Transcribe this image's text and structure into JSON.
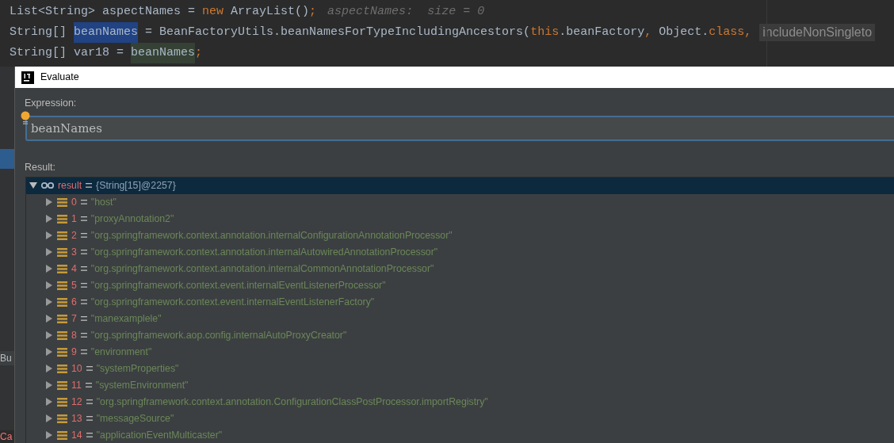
{
  "editor": {
    "lines": [
      [
        {
          "text": "List<String> aspectNames = ",
          "kind": "plain"
        },
        {
          "text": "new",
          "kind": "keyword"
        },
        {
          "text": " ArrayList()",
          "kind": "plain"
        },
        {
          "text": ";",
          "kind": "keyword"
        },
        {
          "text": "aspectNames:  size = 0",
          "kind": "hint"
        }
      ],
      [
        {
          "text": "String[] ",
          "kind": "plain"
        },
        {
          "text": "beanNames",
          "kind": "selection"
        },
        {
          "text": " = BeanFactoryUtils.beanNamesForTypeIncludingAncestors(",
          "kind": "plain"
        },
        {
          "text": "this",
          "kind": "keyword"
        },
        {
          "text": ".beanFactory",
          "kind": "plain"
        },
        {
          "text": ", ",
          "kind": "keyword"
        },
        {
          "text": "Object.",
          "kind": "plain"
        },
        {
          "text": "class",
          "kind": "keyword"
        },
        {
          "text": ",",
          "kind": "keyword"
        },
        {
          "text": "includeNonSingleto",
          "kind": "param"
        }
      ],
      [
        {
          "text": "String[] var18 = ",
          "kind": "plain"
        },
        {
          "text": "beanNames",
          "kind": "usage"
        },
        {
          "text": ";",
          "kind": "keyword"
        }
      ]
    ]
  },
  "side_panel": {
    "fragments": [
      {
        "text": "Bu",
        "kind": "plain"
      },
      {
        "text": "Ca",
        "kind": "error"
      }
    ]
  },
  "dialog": {
    "title": "Evaluate",
    "expression_label": "Expression:",
    "expression": "beanNames",
    "result_label": "Result:",
    "result": {
      "name": "result",
      "value": "{String[15]@2257}",
      "expanded": true,
      "selected": true,
      "children": [
        {
          "name": "0",
          "value": "\"host\"",
          "expanded": false,
          "selected": false
        },
        {
          "name": "1",
          "value": "\"proxyAnnotation2\"",
          "expanded": false,
          "selected": false
        },
        {
          "name": "2",
          "value": "\"org.springframework.context.annotation.internalConfigurationAnnotationProcessor\"",
          "expanded": false,
          "selected": false
        },
        {
          "name": "3",
          "value": "\"org.springframework.context.annotation.internalAutowiredAnnotationProcessor\"",
          "expanded": false,
          "selected": false
        },
        {
          "name": "4",
          "value": "\"org.springframework.context.annotation.internalCommonAnnotationProcessor\"",
          "expanded": false,
          "selected": false
        },
        {
          "name": "5",
          "value": "\"org.springframework.context.event.internalEventListenerProcessor\"",
          "expanded": false,
          "selected": false
        },
        {
          "name": "6",
          "value": "\"org.springframework.context.event.internalEventListenerFactory\"",
          "expanded": false,
          "selected": false
        },
        {
          "name": "7",
          "value": "\"manexamplele\"",
          "expanded": false,
          "selected": false
        },
        {
          "name": "8",
          "value": "\"org.springframework.aop.config.internalAutoProxyCreator\"",
          "expanded": false,
          "selected": false
        },
        {
          "name": "9",
          "value": "\"environment\"",
          "expanded": false,
          "selected": false
        },
        {
          "name": "10",
          "value": "\"systemProperties\"",
          "expanded": false,
          "selected": false
        },
        {
          "name": "11",
          "value": "\"systemEnvironment\"",
          "expanded": false,
          "selected": false
        },
        {
          "name": "12",
          "value": "\"org.springframework.context.annotation.ConfigurationClassPostProcessor.importRegistry\"",
          "expanded": false,
          "selected": false
        },
        {
          "name": "13",
          "value": "\"messageSource\"",
          "expanded": false,
          "selected": false
        },
        {
          "name": "14",
          "value": "\"applicationEventMulticaster\"",
          "expanded": false,
          "selected": false
        }
      ]
    }
  }
}
